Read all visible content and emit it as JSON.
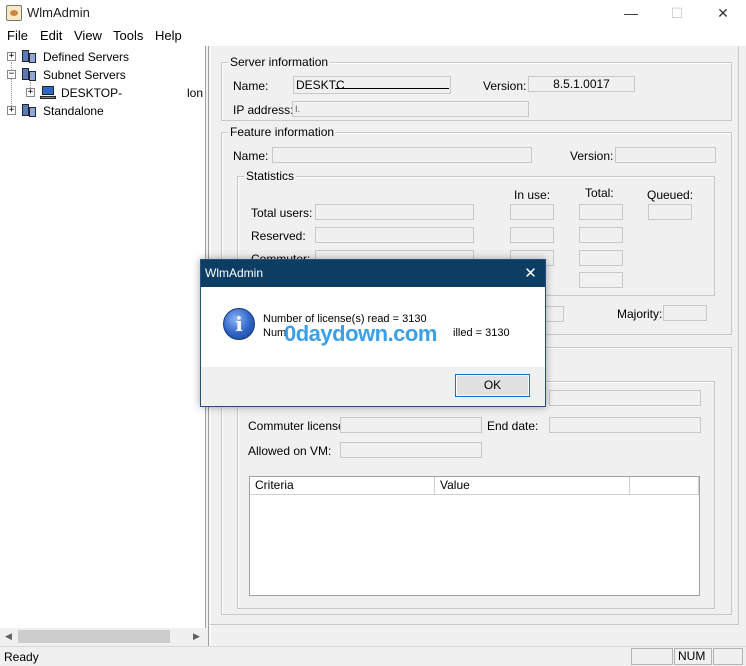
{
  "window": {
    "title": "WlmAdmin",
    "minimize": "—",
    "maximize": "☐",
    "close": "✕"
  },
  "menu": {
    "items": [
      "File",
      "Edit",
      "View",
      "Tools",
      "Help"
    ]
  },
  "tree": {
    "defined_servers": "Defined Servers",
    "subnet_servers": "Subnet Servers",
    "desktop": "DESKTOP-",
    "desktop_trail": "lon",
    "standalone": "Standalone",
    "expand_glyph": "+",
    "collapse_glyph": "−"
  },
  "server_info": {
    "group_title": "Server information",
    "name_label": "Name:",
    "name_value": "DESKTC",
    "version_label": "Version:",
    "version_value": "8.5.1.0017",
    "ip_label": "IP address:",
    "ip_value": "I."
  },
  "feature_info": {
    "group_title": "Feature information",
    "name_label": "Name:",
    "version_label": "Version:"
  },
  "statistics": {
    "group_title": "Statistics",
    "col_in_use": "In use:",
    "col_total": "Total:",
    "col_queued": "Queued:",
    "row_total_users": "Total users:",
    "row_reserved": "Reserved:",
    "row_commuter": "Commuter:",
    "majority_label": "Majority:"
  },
  "license_info": {
    "commuter_license_label": "Commuter license:",
    "end_date_label": "End date:",
    "allowed_vm_label": "Allowed on VM:",
    "table_headers": [
      "Criteria",
      "Value",
      ""
    ]
  },
  "status": {
    "left": "Ready",
    "num": "NUM"
  },
  "dialog": {
    "title": "WlmAdmin",
    "close": "✕",
    "line1": "Number of license(s) read = 3130",
    "line2_start": "Num",
    "line2_end": "illed = 3130",
    "ok": "OK",
    "icon_glyph": "i"
  },
  "watermark": "0daydown.com",
  "colors": {
    "dialog_titlebar": "#0d3d63",
    "ok_border": "#0078d7",
    "watermark": "#1a8fe6"
  }
}
